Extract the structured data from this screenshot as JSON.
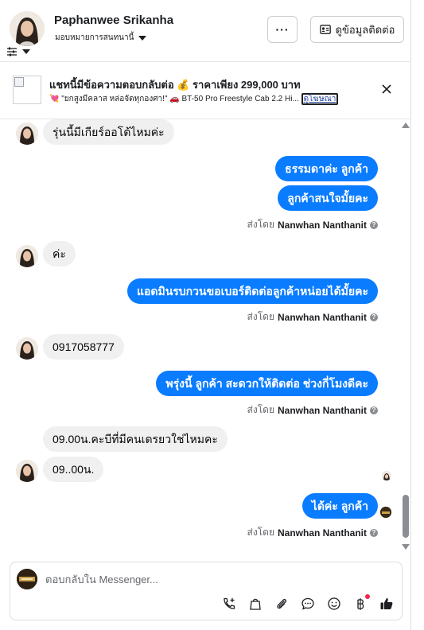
{
  "header": {
    "contact_name": "Paphanwee Srikanha",
    "assign_label": "มอบหมายการสนทนานี้",
    "more_label": "···",
    "details_label": "ดูข้อมูลติดต่อ"
  },
  "ad": {
    "title": "แชทนี้มีข้อความตอบกลับต่อ 💰 ราคาเพียง 299,000 บาท",
    "subtitle": "💘 \"ยกสูงมีคลาส หล่อจัดทุกองศา!\" 🚗 BT-50 Pro Freestyle Cab 2.2 Hi...",
    "link_label": "ดูโฆษณา"
  },
  "messages": [
    {
      "dir": "in",
      "text": "รุ่นนี้มีเกียร์ออโต้ไหมค่ะ"
    },
    {
      "dir": "out",
      "text": "ธรรมดาค่ะ  ลูกค้า"
    },
    {
      "dir": "out",
      "text": "ลูกค้าสนใจมั้ยคะ"
    },
    {
      "dir": "in",
      "text": "ค่ะ"
    },
    {
      "dir": "out",
      "text": "แอดมินรบกวนขอเบอร์ติดต่อลูกค้าหน่อยได้มั้ยคะ"
    },
    {
      "dir": "in",
      "text": "0917058777"
    },
    {
      "dir": "out",
      "text": "พรุ่งนี้ ลูกค้า  สะดวกให้ติดต่อ ช่วงกี่โมงดีคะ"
    },
    {
      "dir": "in",
      "text": "09.00น.คะบีที่มีคนเดรยวใช่ไหมคะ"
    },
    {
      "dir": "in",
      "text": "09..00น."
    },
    {
      "dir": "out",
      "text": "ได้ค่ะ  ลูกค้า"
    }
  ],
  "sent_by": {
    "prefix": "ส่งโดย",
    "name": "Nanwhan Nanthanit",
    "help": "?"
  },
  "composer": {
    "placeholder": "ตอบกลับใน Messenger..."
  },
  "colors": {
    "outgoing_bubble": "#0a7cff",
    "incoming_bubble": "#f0f0f0",
    "notification_dot": "#f02849"
  }
}
